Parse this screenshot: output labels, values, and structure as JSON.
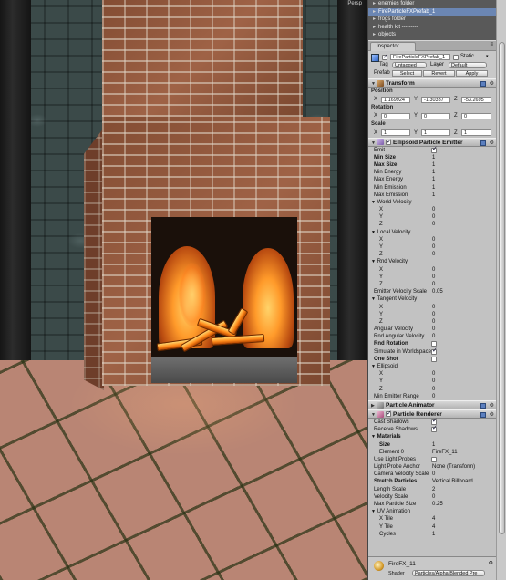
{
  "scene": {
    "view_label": "Persp"
  },
  "hierarchy": {
    "items": [
      {
        "label": "enemies folder",
        "selected": false
      },
      {
        "label": "FireParticleFXPrefab_1",
        "selected": true
      },
      {
        "label": "frogs folder",
        "selected": false
      },
      {
        "label": "health kit ---------",
        "selected": false
      },
      {
        "label": "objects",
        "selected": false
      }
    ]
  },
  "inspector": {
    "tab_label": "Inspector",
    "menu_icon": "menu-icon",
    "object": {
      "name": "FireParticleFXPrefab_1",
      "static_label": "Static",
      "tag_label": "Tag",
      "tag_value": "Untagged",
      "layer_label": "Layer",
      "layer_value": "Default",
      "prefab_label": "Prefab",
      "prefab_buttons": [
        "Select",
        "Revert",
        "Apply"
      ]
    },
    "transform": {
      "title": "Transform",
      "position_label": "Position",
      "position": {
        "x": "1.169924",
        "y": "-1.30337",
        "z": "-53.2695"
      },
      "rotation_label": "Rotation",
      "rotation": {
        "x": "0",
        "y": "0",
        "z": "0"
      },
      "scale_label": "Scale",
      "scale": {
        "x": "1",
        "y": "1",
        "z": "1"
      }
    },
    "emitter": {
      "title": "Ellipsoid Particle Emitter",
      "rows1": [
        {
          "label": "Emit",
          "check": true
        },
        {
          "label": "Min Size",
          "value": "1",
          "bold": true
        },
        {
          "label": "Max Size",
          "value": "1",
          "bold": true
        },
        {
          "label": "Min Energy",
          "value": "1"
        },
        {
          "label": "Max Energy",
          "value": "1"
        },
        {
          "label": "Min Emission",
          "value": "1"
        },
        {
          "label": "Max Emission",
          "value": "1"
        }
      ],
      "world_velocity": {
        "label": "World Velocity",
        "x": "0",
        "y": "0",
        "z": "0"
      },
      "local_velocity": {
        "label": "Local Velocity",
        "x": "0",
        "y": "0",
        "z": "0"
      },
      "rnd_velocity": {
        "label": "Rnd Velocity",
        "x": "0",
        "y": "0",
        "z": "0"
      },
      "emitter_velocity_scale": {
        "label": "Emitter Velocity Scale",
        "value": "0.05"
      },
      "tangent_velocity": {
        "label": "Tangent Velocity",
        "x": "0",
        "y": "0",
        "z": "0"
      },
      "rows2": [
        {
          "label": "Angular Velocity",
          "value": "0"
        },
        {
          "label": "Rnd Angular Velocity",
          "value": "0"
        },
        {
          "label": "Rnd Rotation",
          "check": false,
          "bold": true
        },
        {
          "label": "Simulate in Worldspace",
          "check": true
        },
        {
          "label": "One Shot",
          "check": false,
          "bold": true
        }
      ],
      "ellipsoid": {
        "label": "Ellipsoid",
        "x": "0",
        "y": "0",
        "z": "0"
      },
      "min_emitter_range": {
        "label": "Min Emitter Range",
        "value": "0"
      }
    },
    "animator": {
      "title": "Particle Animator"
    },
    "renderer": {
      "title": "Particle Renderer",
      "cast_shadows": {
        "label": "Cast Shadows",
        "check": true
      },
      "receive_shadows": {
        "label": "Receive Shadows",
        "check": true
      },
      "materials_label": "Materials",
      "materials_rows": [
        {
          "label": "Size",
          "value": "1",
          "bold": true
        },
        {
          "label": "Element 0",
          "value": "FireFX_11"
        }
      ],
      "rows": [
        {
          "label": "Use Light Probes",
          "check": false
        },
        {
          "label": "Light Probe Anchor",
          "value": "None (Transform)"
        },
        {
          "label": "Camera Velocity Scale",
          "value": "0"
        },
        {
          "label": "Stretch Particles",
          "value": "Vertical Billboard",
          "bold": true
        },
        {
          "label": "Length Scale",
          "value": "2"
        },
        {
          "label": "Velocity Scale",
          "value": "0"
        },
        {
          "label": "Max Particle Size",
          "value": "0.25"
        }
      ],
      "uv_label": "UV Animation",
      "uv_rows": [
        {
          "label": "X Tile",
          "value": "4"
        },
        {
          "label": "Y Tile",
          "value": "4"
        },
        {
          "label": "Cycles",
          "value": "1"
        }
      ]
    },
    "material": {
      "name": "FireFX_11",
      "shader_label": "Shader",
      "shader_value": "Particles/Alpha Blended Pre"
    }
  }
}
